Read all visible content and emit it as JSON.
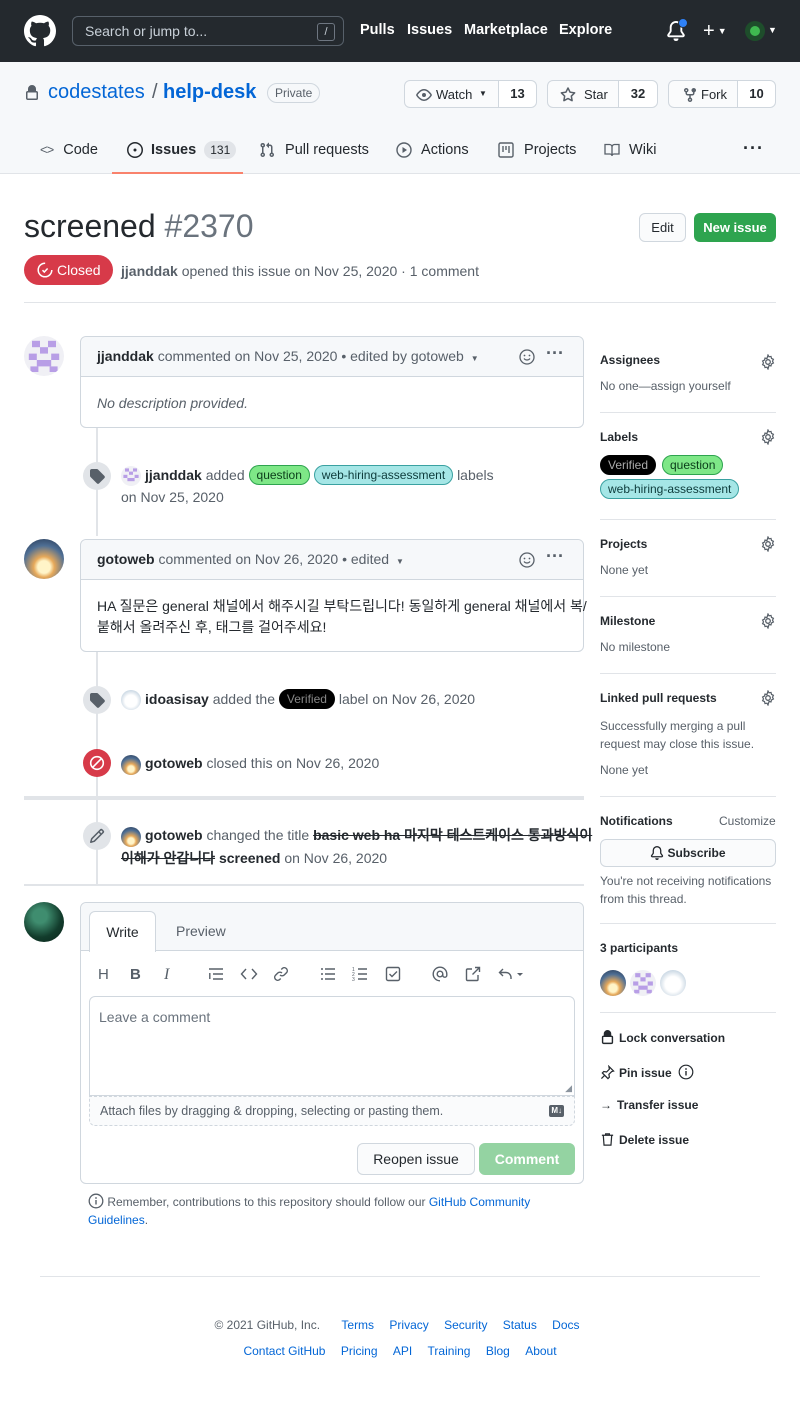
{
  "header": {
    "search_placeholder": "Search or jump to...",
    "slash_key": "/",
    "nav": [
      "Pulls",
      "Issues",
      "Marketplace",
      "Explore"
    ]
  },
  "repo": {
    "owner": "codestates",
    "separator": "/",
    "name": "help-desk",
    "visibility": "Private",
    "watch": {
      "label": "Watch",
      "count": "13"
    },
    "star": {
      "label": "Star",
      "count": "32"
    },
    "fork": {
      "label": "Fork",
      "count": "10"
    },
    "tabs": [
      {
        "label": "Code"
      },
      {
        "label": "Issues",
        "count": "131"
      },
      {
        "label": "Pull requests"
      },
      {
        "label": "Actions"
      },
      {
        "label": "Projects"
      },
      {
        "label": "Wiki"
      }
    ]
  },
  "issue": {
    "title": "screened",
    "number": "#2370",
    "edit_label": "Edit",
    "new_issue_label": "New issue",
    "state": "Closed",
    "author": "jjanddak",
    "meta": "opened this issue on Nov 25, 2020 · 1 comment"
  },
  "timeline": {
    "comment1": {
      "author": "jjanddak",
      "meta": "commented on Nov 25, 2020 • edited by gotoweb",
      "body": "No description provided."
    },
    "event_labels": {
      "user": "jjanddak",
      "verb": "added",
      "label1": "question",
      "label2": "web-hiring-assessment",
      "suffix": "labels",
      "date": "on Nov 25, 2020"
    },
    "comment2": {
      "author": "gotoweb",
      "meta": "commented on Nov 26, 2020 • edited",
      "body_line1": "HA 질문은 general 채널에서 해주시길 부탁드립니다! 동일하게 general 채널에서 복/",
      "body_line2": "붙해서 올려주신 후, 태그를 걸어주세요!"
    },
    "event_verified": {
      "user": "idoasisay",
      "verb": "added the",
      "label": "Verified",
      "suffix": "label",
      "date": "on Nov 26, 2020"
    },
    "event_closed": {
      "user": "gotoweb",
      "verb": "closed this",
      "date": "on Nov 26, 2020"
    },
    "event_title": {
      "user": "gotoweb",
      "verb": "changed the title",
      "old_line1": "basic web ha 마지막 테스트케이스 통과방식이",
      "old_line2": "이해가 안갑니다",
      "new": "screened",
      "date": "on Nov 26, 2020"
    }
  },
  "editor": {
    "tab_write": "Write",
    "tab_preview": "Preview",
    "placeholder": "Leave a comment",
    "attach_hint": "Attach files by dragging & dropping, selecting or pasting them.",
    "md_badge": "M↓",
    "reopen_label": "Reopen issue",
    "comment_label": "Comment",
    "remember_text": "Remember, contributions to this repository should follow our",
    "guidelines_link_1": "GitHub Community",
    "guidelines_link_2": "Guidelines",
    "period": "."
  },
  "sidebar": {
    "assignees_title": "Assignees",
    "assignees_value": "No one—assign yourself",
    "labels_title": "Labels",
    "labels": [
      "Verified",
      "question",
      "web-hiring-assessment"
    ],
    "projects_title": "Projects",
    "projects_value": "None yet",
    "milestone_title": "Milestone",
    "milestone_value": "No milestone",
    "linked_title": "Linked pull requests",
    "linked_line1": "Successfully merging a pull",
    "linked_line2": "request may close this issue.",
    "linked_value": "None yet",
    "notifications_title": "Notifications",
    "customize": "Customize",
    "subscribe": "Subscribe",
    "notif_line1": "You're not receiving notifications",
    "notif_line2": "from this thread.",
    "participants": "3 participants",
    "lock": "Lock conversation",
    "pin": "Pin issue",
    "transfer": "Transfer issue",
    "delete": "Delete issue"
  },
  "footer": {
    "copyright": "© 2021 GitHub, Inc.",
    "row1": [
      "Terms",
      "Privacy",
      "Security",
      "Status",
      "Docs"
    ],
    "row2": [
      "Contact GitHub",
      "Pricing",
      "API",
      "Training",
      "Blog",
      "About"
    ]
  },
  "colors": {
    "header_bg": "#24292e",
    "link": "#0366d6",
    "closed_red": "#d73a49",
    "green": "#2ea44f",
    "label_question": "#7ee787",
    "label_web": "#a5e6e6",
    "label_verified": "#000000"
  }
}
